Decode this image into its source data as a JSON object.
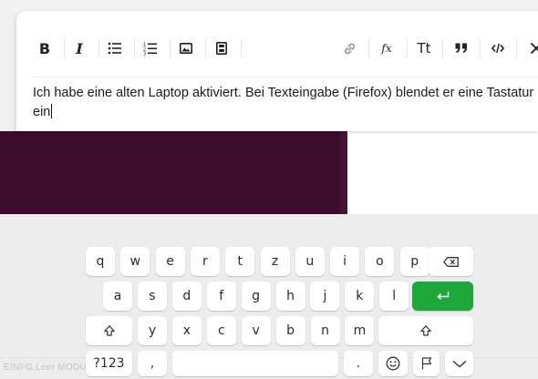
{
  "editor": {
    "text_line1": "Ich habe eine alten Laptop aktiviert. Bei Texteingabe (Firefox) blendet er eine Tastatur",
    "text_line2": "ein",
    "toolbar": {
      "bold_label": "B",
      "italic_label": "I",
      "formula_label": "fx",
      "text_size_label": "Tt",
      "quote_label": "”",
      "code_label": "</>"
    }
  },
  "background": {
    "footer_text": "EINFG   Leer   MODUS"
  },
  "keyboard": {
    "row1": [
      "q",
      "w",
      "e",
      "r",
      "t",
      "z",
      "u",
      "i",
      "o",
      "p"
    ],
    "row2": [
      "a",
      "s",
      "d",
      "f",
      "g",
      "h",
      "j",
      "k",
      "l"
    ],
    "row3": [
      "y",
      "x",
      "c",
      "v",
      "b",
      "n",
      "m"
    ],
    "symbols_label": "?123",
    "comma_label": ",",
    "period_label": ".",
    "enter_color": "#1ea83c"
  }
}
